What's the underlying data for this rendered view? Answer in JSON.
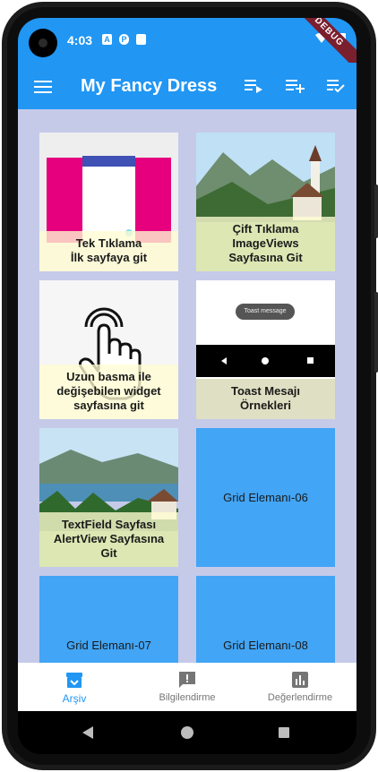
{
  "status_bar": {
    "time": "4:03",
    "debug_label": "DEBUG"
  },
  "app_bar": {
    "title": "My Fancy Dress"
  },
  "grid": [
    {
      "label": "Tek Tıklama\nİlk sayfaya git"
    },
    {
      "label": "Çift Tıklama\nImageViews\nSayfasına Git"
    },
    {
      "label": "Uzun basma ile\ndeğişebilen widget\nsayfasına git"
    },
    {
      "label": "Toast Mesajı\nÖrnekleri",
      "toast": "Toast message"
    },
    {
      "label": "TextField Sayfası\nAlertView Sayfasına\nGit"
    },
    {
      "label": "Grid Elemanı-06"
    },
    {
      "label": "Grid Elemanı-07"
    },
    {
      "label": "Grid Elemanı-08"
    }
  ],
  "bottom_nav": [
    {
      "label": "Arşiv",
      "icon": "archive-icon",
      "active": true
    },
    {
      "label": "Bilgilendirme",
      "icon": "feedback-icon",
      "active": false
    },
    {
      "label": "Değerlendirme",
      "icon": "bar-chart-icon",
      "active": false
    }
  ],
  "colors": {
    "primary": "#2196f3",
    "grid_background": "#c5cae9",
    "tile_blue": "#42a5f5"
  }
}
